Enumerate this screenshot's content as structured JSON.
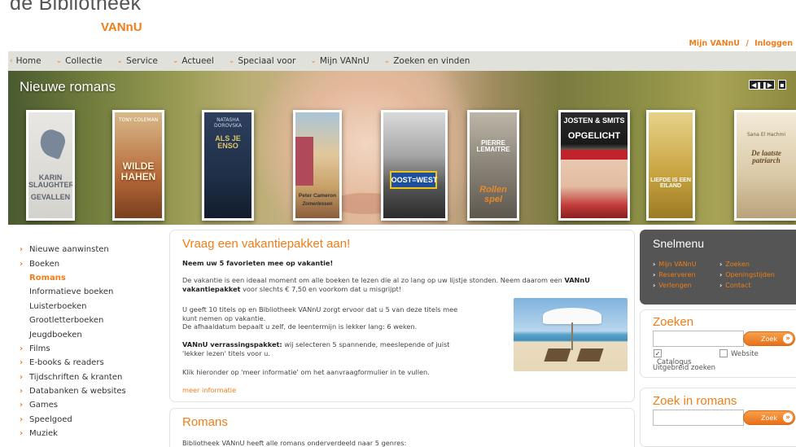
{
  "header": {
    "logo_main": "de Bibliotheek",
    "logo_sub": "VANnU",
    "account_link": "Mijn VANnU",
    "separator": "/",
    "login_link": "Inloggen"
  },
  "nav": {
    "items": [
      {
        "chevron": "‹",
        "label": "Home"
      },
      {
        "chevron": "⌄",
        "label": "Collectie"
      },
      {
        "chevron": "⌄",
        "label": "Service"
      },
      {
        "chevron": "⌄",
        "label": "Actueel"
      },
      {
        "chevron": "⌄",
        "label": "Speciaal voor"
      },
      {
        "chevron": "⌄",
        "label": "Mijn VANnU"
      },
      {
        "chevron": "⌄",
        "label": "Zoeken en vinden"
      }
    ]
  },
  "hero": {
    "title": "Nieuwe romans",
    "pager_icon": "play-pause-icon",
    "books": [
      {
        "author": "KARIN SLAUGHTER",
        "title": "GEVALLEN",
        "author_small": "",
        "color": "#9aa4b2"
      },
      {
        "author": "TONY COLEMAN",
        "title": "WILDE HAHEN",
        "author_small": "",
        "color": "#b86a3a"
      },
      {
        "author": "NATASHA DOROVSKA",
        "title": "ALS JE ENSO",
        "author_small": "",
        "color": "#1f2f48"
      },
      {
        "author": "Peter Cameron",
        "title": "Zomerlessen",
        "author_small": "",
        "color": "#c9a26a"
      },
      {
        "author": "",
        "title": "OOST=WEST",
        "author_small": "",
        "color": "#2b2b2b"
      },
      {
        "author": "PIERRE LEMAITRE",
        "title": "Rollen spel",
        "author_small": "",
        "color": "#8a8478"
      },
      {
        "author": "JOSTEN & SMITS",
        "title": "OPGELICHT",
        "author_small": "",
        "color": "#1a1a1a"
      },
      {
        "author": "",
        "title": "LIEFDE IS EEN EILAND",
        "author_small": "",
        "color": "#c7a23e"
      },
      {
        "author": "Sana El Hachmi",
        "title": "De laatste patriarch",
        "author_small": "",
        "color": "#d9c9a6"
      }
    ]
  },
  "sidebar": {
    "items": [
      {
        "label": "Nieuwe aanwinsten",
        "arrow": "›",
        "type": "top",
        "active": false
      },
      {
        "label": "Boeken",
        "arrow": "›",
        "type": "top",
        "active": false
      },
      {
        "label": "Romans",
        "arrow": "",
        "type": "sub",
        "active": true
      },
      {
        "label": "Informatieve boeken",
        "arrow": "",
        "type": "sub",
        "active": false
      },
      {
        "label": "Luisterboeken",
        "arrow": "",
        "type": "sub",
        "active": false
      },
      {
        "label": "Grootletterboeken",
        "arrow": "",
        "type": "sub",
        "active": false
      },
      {
        "label": "Jeugdboeken",
        "arrow": "",
        "type": "sub",
        "active": false
      },
      {
        "label": "Films",
        "arrow": "›",
        "type": "top",
        "active": false
      },
      {
        "label": "E-books & readers",
        "arrow": "›",
        "type": "top",
        "active": false
      },
      {
        "label": "Tijdschriften & kranten",
        "arrow": "›",
        "type": "top",
        "active": false
      },
      {
        "label": "Databanken & websites",
        "arrow": "›",
        "type": "top",
        "active": false
      },
      {
        "label": "Games",
        "arrow": "›",
        "type": "top",
        "active": false
      },
      {
        "label": "Speelgoed",
        "arrow": "›",
        "type": "top",
        "active": false
      },
      {
        "label": "Muziek",
        "arrow": "›",
        "type": "top",
        "active": false
      }
    ]
  },
  "promo": {
    "title": "Vraag een vakantiepakket aan!",
    "lead": "Neem uw 5 favorieten mee op vakantie!",
    "p1": "De vakantie is een ideaal moment om alle boeken te lezen die al zo lang op uw lijstje stonden. Neem daarom een",
    "p1_bold": "VANnU vakantiepakket",
    "p1_end": "voor slechts € 7,50 en voorkom dat u misgrijpt!",
    "p2_line1": "U geeft 10 titels op en Bibliotheek VANnU zorgt ervoor dat u 5 van deze titels mee",
    "p2_line2": "kunt nemen op vakantie.",
    "p2_line3": "De afhaaldatum bepaalt u zelf, de leentermijn is lekker lang: 6 weken.",
    "p3_bold": "VANnU verrassingspakket:",
    "p3_line1": "wij selecteren 5 spannende, meeslepende of juist",
    "p3_line2": "'lekker lezen' titels voor u.",
    "p4": "Klik hieronder op 'meer informatie' om het aanvraagformulier in te vullen.",
    "more_link": "meer informatie"
  },
  "romans": {
    "title": "Romans",
    "text": "Bibliotheek VANnU heeft alle romans onderverdeeld naar 5 genres:"
  },
  "snelmenu": {
    "title": "Snelmenu",
    "items": [
      {
        "label": "Mijn VANnU",
        "arrow": "›"
      },
      {
        "label": "Zoeken",
        "arrow": "›"
      },
      {
        "label": "Reserveren",
        "arrow": "›"
      },
      {
        "label": "Openingstijden",
        "arrow": "›"
      },
      {
        "label": "Verlengen",
        "arrow": "›"
      },
      {
        "label": "Contact",
        "arrow": "›"
      }
    ]
  },
  "search": {
    "title": "Zoeken",
    "value": "",
    "button": "Zoek",
    "option_catalogus": "Catalogus",
    "option_catalogus_checked": "✓",
    "option_website": "Website",
    "advanced": "Uitgebreid zoeken"
  },
  "search_romans": {
    "title": "Zoek in romans",
    "value": "",
    "button": "Zoek"
  }
}
